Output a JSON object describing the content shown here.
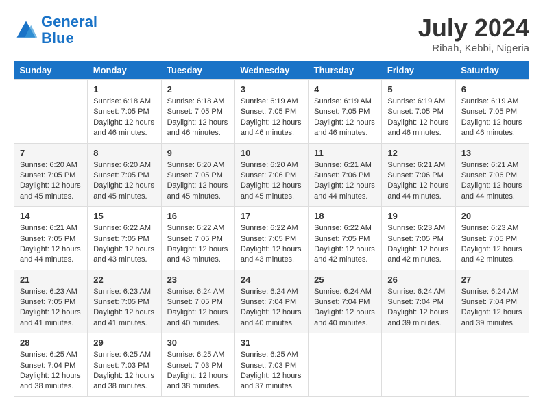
{
  "header": {
    "logo_line1": "General",
    "logo_line2": "Blue",
    "month": "July 2024",
    "location": "Ribah, Kebbi, Nigeria"
  },
  "weekdays": [
    "Sunday",
    "Monday",
    "Tuesday",
    "Wednesday",
    "Thursday",
    "Friday",
    "Saturday"
  ],
  "weeks": [
    [
      {
        "day": "",
        "info": ""
      },
      {
        "day": "1",
        "info": "Sunrise: 6:18 AM\nSunset: 7:05 PM\nDaylight: 12 hours\nand 46 minutes."
      },
      {
        "day": "2",
        "info": "Sunrise: 6:18 AM\nSunset: 7:05 PM\nDaylight: 12 hours\nand 46 minutes."
      },
      {
        "day": "3",
        "info": "Sunrise: 6:19 AM\nSunset: 7:05 PM\nDaylight: 12 hours\nand 46 minutes."
      },
      {
        "day": "4",
        "info": "Sunrise: 6:19 AM\nSunset: 7:05 PM\nDaylight: 12 hours\nand 46 minutes."
      },
      {
        "day": "5",
        "info": "Sunrise: 6:19 AM\nSunset: 7:05 PM\nDaylight: 12 hours\nand 46 minutes."
      },
      {
        "day": "6",
        "info": "Sunrise: 6:19 AM\nSunset: 7:05 PM\nDaylight: 12 hours\nand 46 minutes."
      }
    ],
    [
      {
        "day": "7",
        "info": "Sunrise: 6:20 AM\nSunset: 7:05 PM\nDaylight: 12 hours\nand 45 minutes."
      },
      {
        "day": "8",
        "info": "Sunrise: 6:20 AM\nSunset: 7:05 PM\nDaylight: 12 hours\nand 45 minutes."
      },
      {
        "day": "9",
        "info": "Sunrise: 6:20 AM\nSunset: 7:05 PM\nDaylight: 12 hours\nand 45 minutes."
      },
      {
        "day": "10",
        "info": "Sunrise: 6:20 AM\nSunset: 7:06 PM\nDaylight: 12 hours\nand 45 minutes."
      },
      {
        "day": "11",
        "info": "Sunrise: 6:21 AM\nSunset: 7:06 PM\nDaylight: 12 hours\nand 44 minutes."
      },
      {
        "day": "12",
        "info": "Sunrise: 6:21 AM\nSunset: 7:06 PM\nDaylight: 12 hours\nand 44 minutes."
      },
      {
        "day": "13",
        "info": "Sunrise: 6:21 AM\nSunset: 7:06 PM\nDaylight: 12 hours\nand 44 minutes."
      }
    ],
    [
      {
        "day": "14",
        "info": "Sunrise: 6:21 AM\nSunset: 7:05 PM\nDaylight: 12 hours\nand 44 minutes."
      },
      {
        "day": "15",
        "info": "Sunrise: 6:22 AM\nSunset: 7:05 PM\nDaylight: 12 hours\nand 43 minutes."
      },
      {
        "day": "16",
        "info": "Sunrise: 6:22 AM\nSunset: 7:05 PM\nDaylight: 12 hours\nand 43 minutes."
      },
      {
        "day": "17",
        "info": "Sunrise: 6:22 AM\nSunset: 7:05 PM\nDaylight: 12 hours\nand 43 minutes."
      },
      {
        "day": "18",
        "info": "Sunrise: 6:22 AM\nSunset: 7:05 PM\nDaylight: 12 hours\nand 42 minutes."
      },
      {
        "day": "19",
        "info": "Sunrise: 6:23 AM\nSunset: 7:05 PM\nDaylight: 12 hours\nand 42 minutes."
      },
      {
        "day": "20",
        "info": "Sunrise: 6:23 AM\nSunset: 7:05 PM\nDaylight: 12 hours\nand 42 minutes."
      }
    ],
    [
      {
        "day": "21",
        "info": "Sunrise: 6:23 AM\nSunset: 7:05 PM\nDaylight: 12 hours\nand 41 minutes."
      },
      {
        "day": "22",
        "info": "Sunrise: 6:23 AM\nSunset: 7:05 PM\nDaylight: 12 hours\nand 41 minutes."
      },
      {
        "day": "23",
        "info": "Sunrise: 6:24 AM\nSunset: 7:05 PM\nDaylight: 12 hours\nand 40 minutes."
      },
      {
        "day": "24",
        "info": "Sunrise: 6:24 AM\nSunset: 7:04 PM\nDaylight: 12 hours\nand 40 minutes."
      },
      {
        "day": "25",
        "info": "Sunrise: 6:24 AM\nSunset: 7:04 PM\nDaylight: 12 hours\nand 40 minutes."
      },
      {
        "day": "26",
        "info": "Sunrise: 6:24 AM\nSunset: 7:04 PM\nDaylight: 12 hours\nand 39 minutes."
      },
      {
        "day": "27",
        "info": "Sunrise: 6:24 AM\nSunset: 7:04 PM\nDaylight: 12 hours\nand 39 minutes."
      }
    ],
    [
      {
        "day": "28",
        "info": "Sunrise: 6:25 AM\nSunset: 7:04 PM\nDaylight: 12 hours\nand 38 minutes."
      },
      {
        "day": "29",
        "info": "Sunrise: 6:25 AM\nSunset: 7:03 PM\nDaylight: 12 hours\nand 38 minutes."
      },
      {
        "day": "30",
        "info": "Sunrise: 6:25 AM\nSunset: 7:03 PM\nDaylight: 12 hours\nand 38 minutes."
      },
      {
        "day": "31",
        "info": "Sunrise: 6:25 AM\nSunset: 7:03 PM\nDaylight: 12 hours\nand 37 minutes."
      },
      {
        "day": "",
        "info": ""
      },
      {
        "day": "",
        "info": ""
      },
      {
        "day": "",
        "info": ""
      }
    ]
  ]
}
